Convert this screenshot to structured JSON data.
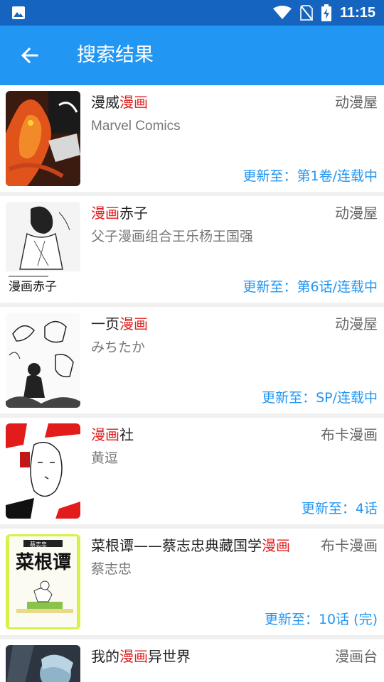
{
  "status_bar": {
    "time": "11:15"
  },
  "app_bar": {
    "title": "搜索结果",
    "back_icon": "arrow-left-icon"
  },
  "colors": {
    "primary": "#2196f3",
    "status": "#1565c0",
    "highlight": "#e02020",
    "update": "#2196f3"
  },
  "results": [
    {
      "title_pre": "漫威",
      "title_hl": "漫画",
      "title_post": "",
      "source": "动漫屋",
      "author": "Marvel Comics",
      "update": "更新至：第1卷/连载中"
    },
    {
      "title_pre": "",
      "title_hl": "漫画",
      "title_post": "赤子",
      "source": "动漫屋",
      "author": "父子漫画组合王乐杨王国强",
      "update": "更新至：第6话/连载中"
    },
    {
      "title_pre": "一页",
      "title_hl": "漫画",
      "title_post": "",
      "source": "动漫屋",
      "author": "みちたか",
      "update": "更新至：SP/连载中"
    },
    {
      "title_pre": "",
      "title_hl": "漫画",
      "title_post": "社",
      "source": "布卡漫画",
      "author": "黄逗",
      "update": "更新至：4话"
    },
    {
      "title_pre": "菜根谭——蔡志忠典藏国学",
      "title_hl": "漫画",
      "title_post": "",
      "source": "布卡漫画",
      "author": "蔡志忠",
      "update": "更新至：10话 (完)"
    },
    {
      "title_pre": "我的",
      "title_hl": "漫画",
      "title_post": "异世界",
      "source": "漫画台",
      "author": "",
      "update": ""
    }
  ],
  "cover_texts": {
    "c2": "漫画赤子",
    "c5_title": "菜根谭",
    "c5_author": "蔡志忠"
  }
}
